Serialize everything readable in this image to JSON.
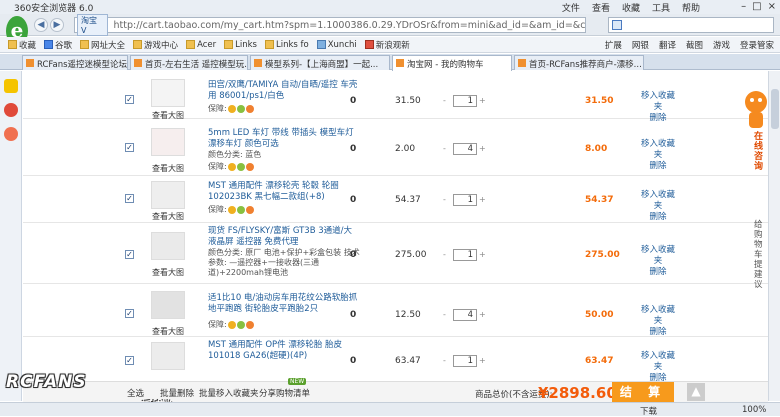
{
  "browser": {
    "title": "360安全浏览器 6.0",
    "menus": [
      "文件",
      "查看",
      "收藏",
      "工具",
      "帮助"
    ],
    "site_badge": "淘宝 V",
    "url": "http://cart.taobao.com/my_cart.htm?spm=1.1000386.0.29.YDrOSr&from=mini&ad_id=&am_id=&cm_id=",
    "search_placeholder": "Q"
  },
  "favorites": [
    "收藏",
    "谷歌",
    "网址大全",
    "游戏中心",
    "Acer",
    "Links",
    "Links fo",
    "Xunchi",
    "新浪观新"
  ],
  "favbar_right": [
    "扩展",
    "网银",
    "翻译",
    "截图",
    "游戏",
    "登录管家"
  ],
  "tabs": [
    "RCFans遥控迷模型论坛|遥...",
    "首页-左右生活 遥控模型玩...",
    "模型系列-【上海商盟】一起...",
    "淘宝网 - 我的购物车",
    "首页-RCFans推荐商户-漂移..."
  ],
  "active_tab": 3,
  "items": [
    {
      "name": "田宫/双鹰/TAMIYA 自动/自晒/遥控 车壳用 86001/ps1/白色",
      "props": "",
      "view_big": "查看大图",
      "guarantee": "保障:",
      "zero": "0",
      "price": "31.50",
      "qty": "1",
      "subtotal": "31.50",
      "op1": "移入收藏夹",
      "op2": "删除"
    },
    {
      "name": "5mm LED 车灯 带线 带插头 模型车灯 漂移车灯 颜色可选",
      "props": "颜色分类: 蓝色",
      "view_big": "查看大图",
      "guarantee": "保障:",
      "zero": "0",
      "price": "2.00",
      "qty": "4",
      "subtotal": "8.00",
      "op1": "移入收藏夹",
      "op2": "删除"
    },
    {
      "name": "MST 通用配件 漂移轮壳 轮毂 轮圈 102023BK 黑七幅二款组(+8)",
      "props": "",
      "view_big": "查看大图",
      "guarantee": "保障:",
      "zero": "0",
      "price": "54.37",
      "qty": "1",
      "subtotal": "54.37",
      "op1": "移入收藏夹",
      "op2": "删除"
    },
    {
      "name": "现货 FS/FLYSKY/富斯 GT3B 3通道/大液晶屏 遥控器 免费代理",
      "props": "颜色分类: 原厂 电池+保护+彩盒包装  技术参数: —遥控器+一接收器(三通道)+2200mah锂电池",
      "view_big": "查看大图",
      "guarantee": "",
      "zero": "0",
      "price": "275.00",
      "qty": "1",
      "subtotal": "275.00",
      "op1": "移入收藏夹",
      "op2": "删除"
    },
    {
      "name": "适1比10 电/油动房车用花纹公路软胎抓地平跑跑 街轮胎皮平跑胎2只",
      "props": "",
      "view_big": "查看大图",
      "guarantee": "保障:",
      "zero": "0",
      "price": "12.50",
      "qty": "4",
      "subtotal": "50.00",
      "op1": "移入收藏夹",
      "op2": "删除"
    },
    {
      "name": "MST 通用配件 OP件 漂移轮胎 胎皮 101018 GA26(超硬)(4P)",
      "props": "",
      "view_big": "查看大图",
      "guarantee": "",
      "zero": "0",
      "price": "63.47",
      "qty": "1",
      "subtotal": "63.47",
      "op1": "移入收藏夹",
      "op2": "删除"
    }
  ],
  "cartbar": {
    "links": [
      "全选",
      "批量删除",
      "批量移入收藏夹",
      "分享购物清单"
    ],
    "new_badge": "NEW",
    "total_label": "商品总价(不含运费):",
    "total": "¥2898.60",
    "checkout": "结 算",
    "totop": "▲"
  },
  "right_float": {
    "consult": "在线咨询",
    "suggest": "给购物车提建议"
  },
  "watermark": {
    "logo": "RCFANS",
    "sub": "遥控迷"
  },
  "statusbar": {
    "download": "下载",
    "zoom": "100%"
  },
  "colors": {
    "accent_orange": "#f79a1c",
    "price_orange": "#f36b0a",
    "link_blue": "#1f5c99"
  }
}
